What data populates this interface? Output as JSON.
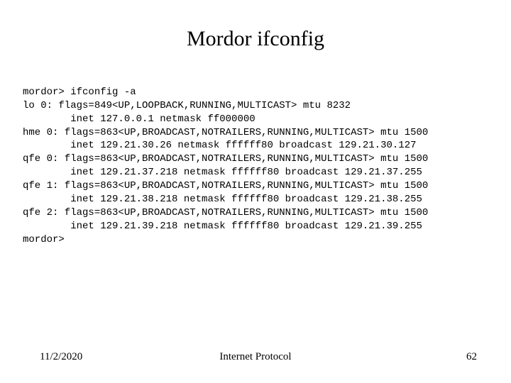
{
  "title": "Mordor ifconfig",
  "terminal": {
    "lines": [
      "mordor> ifconfig -a",
      "lo 0: flags=849<UP,LOOPBACK,RUNNING,MULTICAST> mtu 8232",
      "        inet 127.0.0.1 netmask ff000000",
      "hme 0: flags=863<UP,BROADCAST,NOTRAILERS,RUNNING,MULTICAST> mtu 1500",
      "        inet 129.21.30.26 netmask ffffff80 broadcast 129.21.30.127",
      "qfe 0: flags=863<UP,BROADCAST,NOTRAILERS,RUNNING,MULTICAST> mtu 1500",
      "        inet 129.21.37.218 netmask ffffff80 broadcast 129.21.37.255",
      "qfe 1: flags=863<UP,BROADCAST,NOTRAILERS,RUNNING,MULTICAST> mtu 1500",
      "        inet 129.21.38.218 netmask ffffff80 broadcast 129.21.38.255",
      "qfe 2: flags=863<UP,BROADCAST,NOTRAILERS,RUNNING,MULTICAST> mtu 1500",
      "        inet 129.21.39.218 netmask ffffff80 broadcast 129.21.39.255",
      "mordor>"
    ]
  },
  "footer": {
    "date": "11/2/2020",
    "title": "Internet Protocol",
    "page": "62"
  }
}
